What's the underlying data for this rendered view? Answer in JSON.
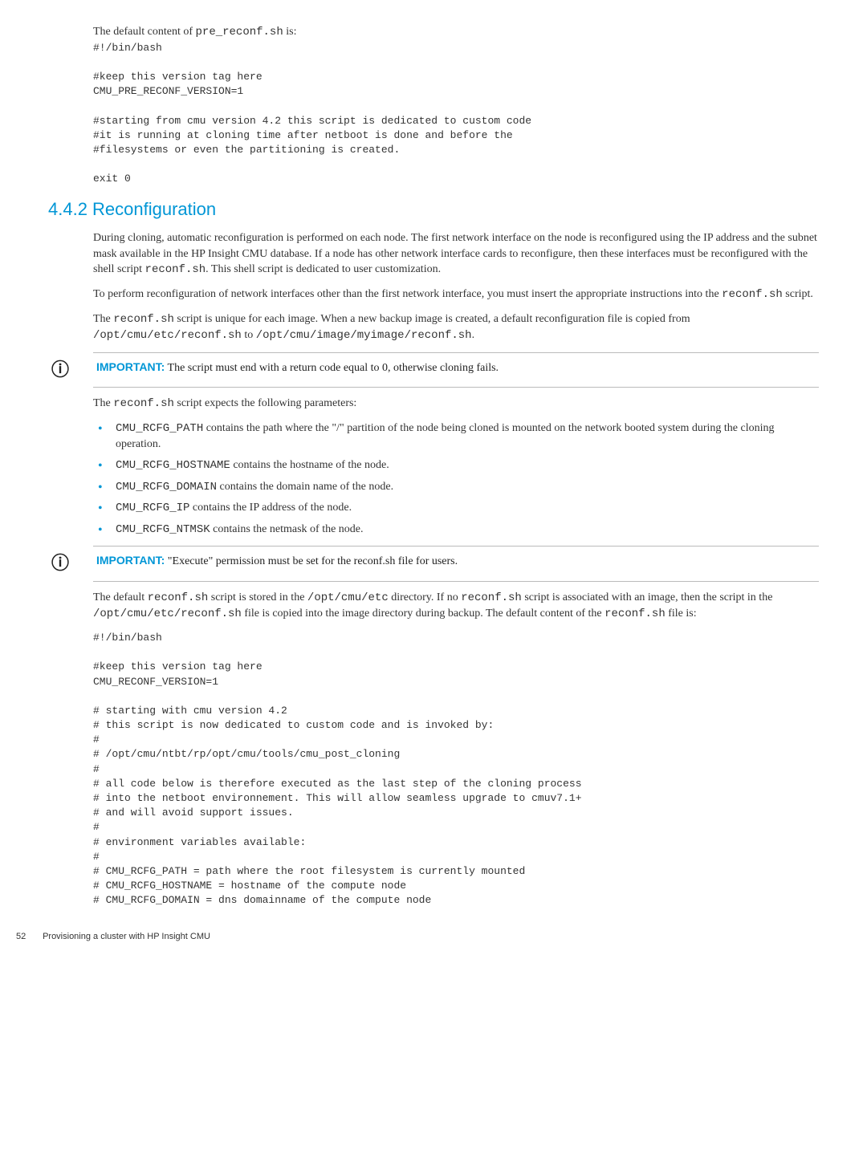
{
  "intro_line": "The default content of ",
  "intro_code": "pre_reconf.sh",
  "intro_tail": " is:",
  "pre_reconf": "#!/bin/bash\n\n#keep this version tag here\nCMU_PRE_RECONF_VERSION=1\n\n#starting from cmu version 4.2 this script is dedicated to custom code\n#it is running at cloning time after netboot is done and before the\n#filesystems or even the partitioning is created.\n\nexit 0",
  "section_heading": "4.4.2 Reconfiguration",
  "p1a": "During cloning, automatic reconfiguration is performed on each node. The first network interface on the node is reconfigured using the IP address and the subnet mask available in the HP Insight CMU database. If a node has other network interface cards to reconfigure, then these interfaces must be reconfigured with the shell script ",
  "p1code": "reconf.sh",
  "p1b": ". This shell script is dedicated to user customization.",
  "p2a": "To perform reconfiguration of network interfaces other than the first network interface, you must insert the appropriate instructions into the ",
  "p2code": "reconf.sh",
  "p2b": " script.",
  "p3a": "The ",
  "p3code1": "reconf.sh",
  "p3b": " script is unique for each image. When a new backup image is created, a default reconfiguration file is copied from ",
  "p3code2": "/opt/cmu/etc/reconf.sh",
  "p3c": " to ",
  "p3code3": "/opt/cmu/image/myimage/reconf.sh",
  "p3d": ".",
  "callout1_label": "IMPORTANT:",
  "callout1_text": " The script must end with a return code equal to 0, otherwise cloning fails.",
  "p4a": "The ",
  "p4code": "reconf.sh",
  "p4b": " script expects the following parameters:",
  "bullets": [
    {
      "code": "CMU_RCFG_PATH",
      "text": " contains the path where the \"/\" partition of the node being cloned is mounted on the network booted system during the cloning operation."
    },
    {
      "code": "CMU_RCFG_HOSTNAME",
      "text": " contains the hostname of the node."
    },
    {
      "code": "CMU_RCFG_DOMAIN",
      "text": " contains the domain name of the node."
    },
    {
      "code": "CMU_RCFG_IP",
      "text": " contains the IP address of the node."
    },
    {
      "code": "CMU_RCFG_NTMSK",
      "text": " contains the netmask of the node."
    }
  ],
  "callout2_label": "IMPORTANT:",
  "callout2_text_a": " \"Execute\" permission must be set for the ",
  "callout2_code": "reconf.sh",
  "callout2_text_b": " file for users.",
  "p5a": "The default ",
  "p5code1": "reconf.sh",
  "p5b": " script is stored in the ",
  "p5code2": "/opt/cmu/etc",
  "p5c": " directory. If no ",
  "p5code3": "reconf.sh",
  "p5d": " script is associated with an image, then the script in the ",
  "p5code4": "/opt/cmu/etc/reconf.sh",
  "p5e": " file is copied into the image directory during backup. The default content of the ",
  "p5code5": "reconf.sh",
  "p5f": " file is:",
  "reconf_block": "#!/bin/bash\n\n#keep this version tag here\nCMU_RECONF_VERSION=1\n\n# starting with cmu version 4.2\n# this script is now dedicated to custom code and is invoked by:\n#\n# /opt/cmu/ntbt/rp/opt/cmu/tools/cmu_post_cloning\n#\n# all code below is therefore executed as the last step of the cloning process\n# into the netboot environnement. This will allow seamless upgrade to cmuv7.1+\n# and will avoid support issues.\n#\n# environment variables available:\n#\n# CMU_RCFG_PATH = path where the root filesystem is currently mounted\n# CMU_RCFG_HOSTNAME = hostname of the compute node\n# CMU_RCFG_DOMAIN = dns domainname of the compute node",
  "footer_page": "52",
  "footer_text": "Provisioning a cluster with HP Insight CMU",
  "icon_glyph": "ⓘ"
}
